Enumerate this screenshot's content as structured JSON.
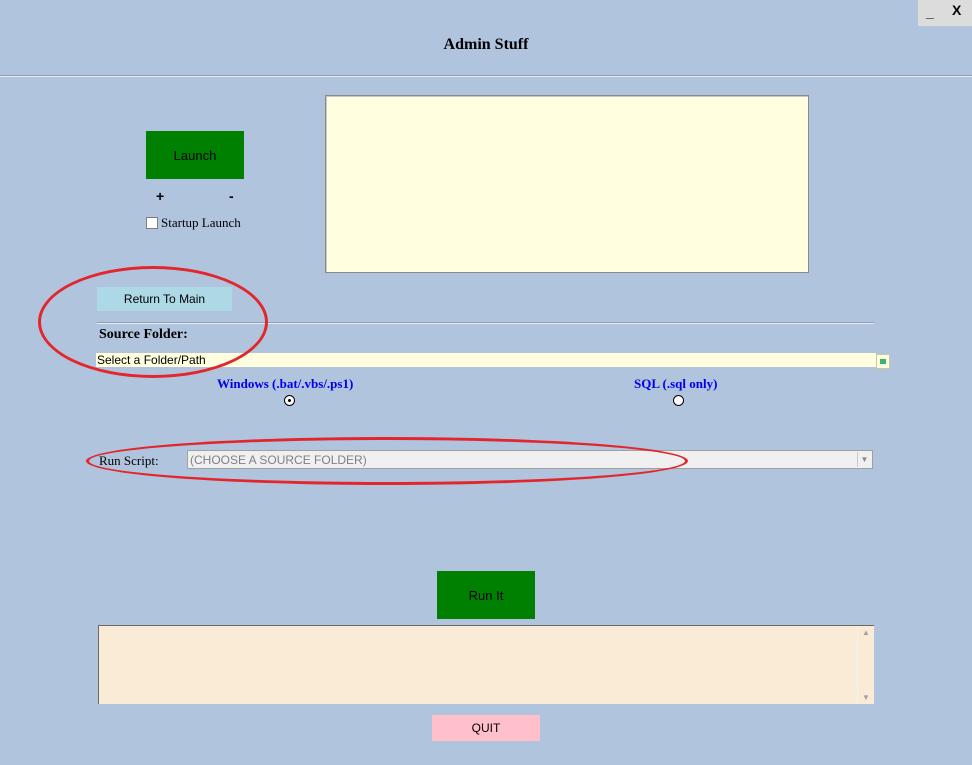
{
  "window": {
    "title": "Admin Stuff",
    "minimize_label": "_",
    "close_label": "X"
  },
  "launch": {
    "button_label": "Launch",
    "plus_label": "+",
    "minus_label": "-",
    "startup_checkbox_label": "Startup Launch",
    "startup_checked": false
  },
  "nav": {
    "return_to_main_label": "Return To Main"
  },
  "source_folder": {
    "label": "Source Folder:",
    "value": "Select a Folder/Path"
  },
  "script_type": {
    "options": [
      {
        "label": "Windows (.bat/.vbs/.ps1)",
        "selected": true
      },
      {
        "label": "SQL (.sql only)",
        "selected": false
      }
    ]
  },
  "run_script": {
    "label": "Run Script:",
    "selected_value": "(CHOOSE A SOURCE FOLDER)"
  },
  "actions": {
    "run_it_label": "Run It",
    "quit_label": "QUIT"
  },
  "colors": {
    "background": "#b0c4de",
    "launch_button": "#008000",
    "run_button": "#008000",
    "return_button": "#add8e6",
    "quit_button": "#ffc0cb",
    "log_box": "#ffffe0",
    "output_box": "#faebd7",
    "radio_label": "#0000ee",
    "annotation": "#e3262c"
  },
  "icons": {
    "folder_browse": "folder-browse-icon",
    "dropdown_arrow": "chevron-down-icon",
    "scroll_up": "chevron-up-icon",
    "scroll_down": "chevron-down-icon"
  }
}
